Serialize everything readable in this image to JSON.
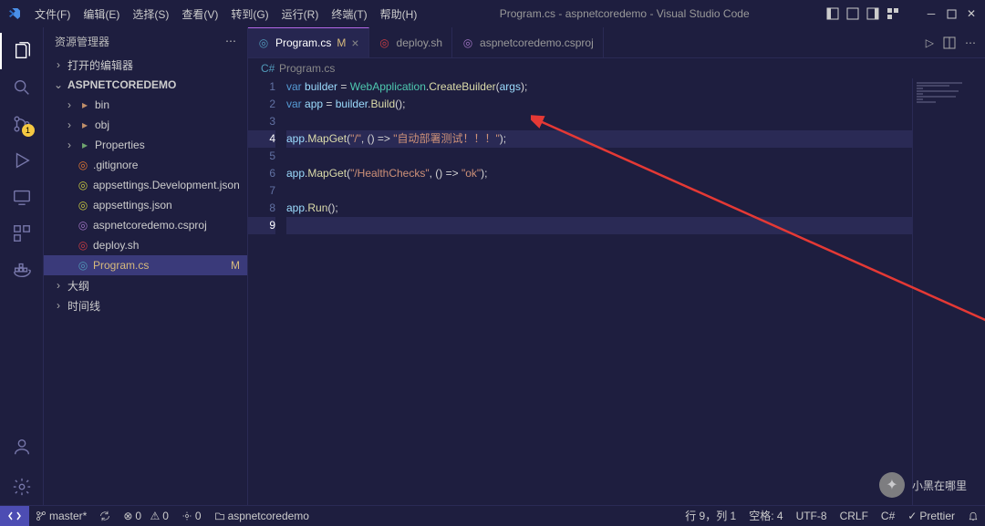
{
  "menu": {
    "file": "文件(F)",
    "edit": "编辑(E)",
    "select": "选择(S)",
    "view": "查看(V)",
    "go": "转到(G)",
    "run": "运行(R)",
    "terminal": "终端(T)",
    "help": "帮助(H)"
  },
  "window_title": "Program.cs - aspnetcoredemo - Visual Studio Code",
  "sidebar": {
    "title": "资源管理器",
    "sections": {
      "open_editors": "打开的编辑器",
      "workspace": "ASPNETCOREDEMO",
      "outline": "大纲",
      "timeline": "时间线"
    },
    "tree": [
      {
        "name": "bin",
        "type": "folder",
        "color": "orange"
      },
      {
        "name": "obj",
        "type": "folder",
        "color": "grey"
      },
      {
        "name": "Properties",
        "type": "folder",
        "color": "green"
      },
      {
        "name": ".gitignore",
        "type": "file",
        "icon": "orange"
      },
      {
        "name": "appsettings.Development.json",
        "type": "file",
        "icon": "yellow"
      },
      {
        "name": "appsettings.json",
        "type": "file",
        "icon": "yellow"
      },
      {
        "name": "aspnetcoredemo.csproj",
        "type": "file",
        "icon": "purple"
      },
      {
        "name": "deploy.sh",
        "type": "file",
        "icon": "red"
      },
      {
        "name": "Program.cs",
        "type": "file",
        "icon": "teal",
        "status": "M",
        "selected": true
      }
    ]
  },
  "tabs": [
    {
      "label": "Program.cs",
      "icon": "teal",
      "status": "M",
      "active": true
    },
    {
      "label": "deploy.sh",
      "icon": "red"
    },
    {
      "label": "aspnetcoredemo.csproj",
      "icon": "purple"
    }
  ],
  "breadcrumb": {
    "icon": "teal",
    "label": "Program.cs"
  },
  "code": {
    "lines": [
      {
        "n": 1,
        "tokens": [
          [
            "k",
            "var"
          ],
          [
            "p",
            " "
          ],
          [
            "v",
            "builder"
          ],
          [
            "p",
            " = "
          ],
          [
            "t",
            "WebApplication"
          ],
          [
            "p",
            "."
          ],
          [
            "m",
            "CreateBuilder"
          ],
          [
            "p",
            "("
          ],
          [
            "v",
            "args"
          ],
          [
            "p",
            ");"
          ]
        ]
      },
      {
        "n": 2,
        "tokens": [
          [
            "k",
            "var"
          ],
          [
            "p",
            " "
          ],
          [
            "v",
            "app"
          ],
          [
            "p",
            " = "
          ],
          [
            "v",
            "builder"
          ],
          [
            "p",
            "."
          ],
          [
            "m",
            "Build"
          ],
          [
            "p",
            "();"
          ]
        ]
      },
      {
        "n": 3,
        "tokens": []
      },
      {
        "n": 4,
        "tokens": [
          [
            "v",
            "app"
          ],
          [
            "p",
            "."
          ],
          [
            "m",
            "MapGet"
          ],
          [
            "p",
            "("
          ],
          [
            "s",
            "\"/\""
          ],
          [
            "p",
            ", () => "
          ],
          [
            "s",
            "\"自动部署测试！！！\""
          ],
          [
            "p",
            ");"
          ]
        ],
        "current": true
      },
      {
        "n": 5,
        "tokens": []
      },
      {
        "n": 6,
        "tokens": [
          [
            "v",
            "app"
          ],
          [
            "p",
            "."
          ],
          [
            "m",
            "MapGet"
          ],
          [
            "p",
            "("
          ],
          [
            "s",
            "\"/HealthChecks\""
          ],
          [
            "p",
            ", () => "
          ],
          [
            "s",
            "\"ok\""
          ],
          [
            "p",
            ");"
          ]
        ]
      },
      {
        "n": 7,
        "tokens": []
      },
      {
        "n": 8,
        "tokens": [
          [
            "v",
            "app"
          ],
          [
            "p",
            "."
          ],
          [
            "m",
            "Run"
          ],
          [
            "p",
            "();"
          ]
        ]
      },
      {
        "n": 9,
        "tokens": [],
        "current": true
      }
    ]
  },
  "activitybar": {
    "badge": "1"
  },
  "statusbar": {
    "branch": "master*",
    "sync": "",
    "errors": "0",
    "warnings": "0",
    "ports": "0",
    "project": "aspnetcoredemo",
    "cursor": "行 9，列 1",
    "spaces": "空格: 4",
    "encoding": "UTF-8",
    "eol": "CRLF",
    "lang": "C#",
    "prettier": "Prettier",
    "bell": ""
  },
  "watermark": "小黑在哪里"
}
